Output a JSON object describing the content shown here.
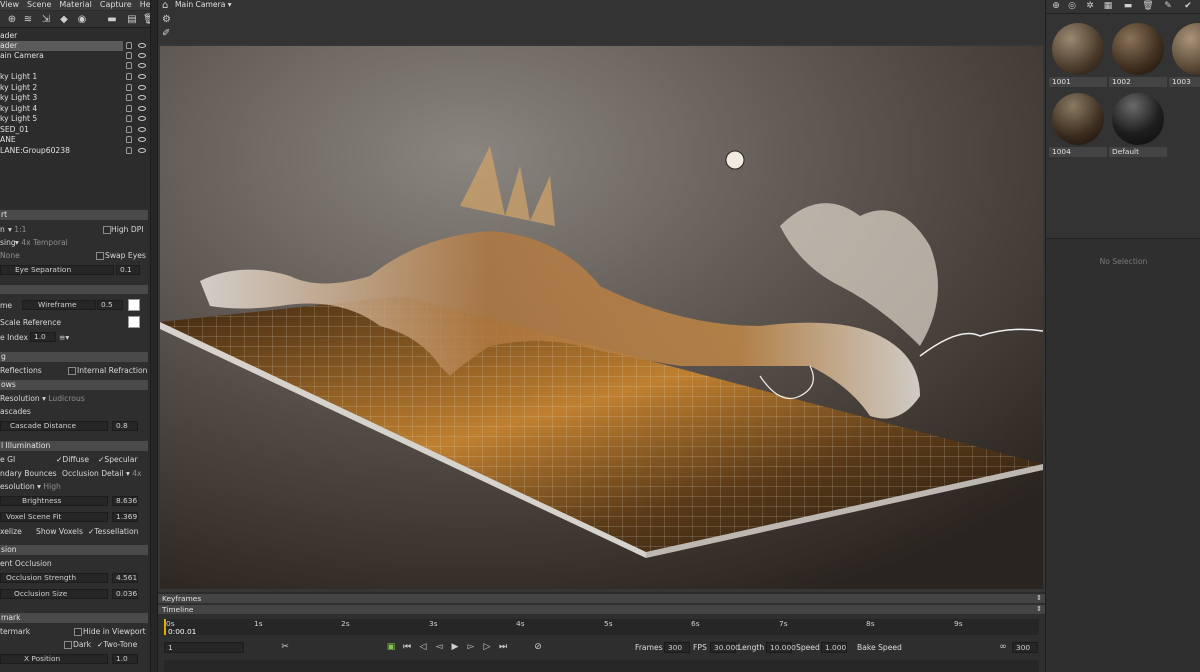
{
  "menubar": [
    "View",
    "Scene",
    "Material",
    "Capture",
    "Help"
  ],
  "left_toolbar_icons": [
    "add-object-icon",
    "clone-icon",
    "import-icon",
    "material-icon",
    "environment-icon",
    "folder-icon",
    "layers-icon",
    "delete-icon"
  ],
  "scene_tree": {
    "items": [
      {
        "label": "ader",
        "selected": true
      },
      {
        "label": "ain Camera",
        "selected": false
      },
      {
        "label": "",
        "selected": false
      },
      {
        "label": "ky Light 1",
        "selected": false
      },
      {
        "label": "ky Light 2",
        "selected": false
      },
      {
        "label": "ky Light 3",
        "selected": false
      },
      {
        "label": "ky Light 4",
        "selected": false
      },
      {
        "label": "ky Light 5",
        "selected": false
      },
      {
        "label": "SED_01",
        "selected": false
      },
      {
        "label": "ANE",
        "selected": false
      },
      {
        "label": "LANE:Group60238",
        "selected": false
      }
    ]
  },
  "props": {
    "rt_header": "rt",
    "res_label": "n",
    "res_value": "1:1",
    "high_dpi": "High DPI",
    "sampling_label": "sing",
    "sampling_value": "4x Temporal",
    "none_value": "None",
    "swap_eyes": "Swap Eyes",
    "eye_sep": "Eye Separation",
    "eye_sep_val": "0.1",
    "frame_label": "me",
    "wireframe": "Wireframe",
    "wire_val": "0.5",
    "scale_ref": "Scale Reference",
    "index_label": "e Index",
    "index_val": "1.0",
    "refl_header": "g",
    "reflections": "Reflections",
    "internal_refraction": "Internal Refraction",
    "shadows_header": "ows",
    "shadow_res": "Resolution",
    "shadow_res_val": "Ludicrous",
    "cascades": "ascades",
    "cascade_dist": "Cascade Distance",
    "cascade_val": "0.8",
    "gi_header": "l Illumination",
    "gi_label": "e GI",
    "diffuse": "Diffuse",
    "specular": "Specular",
    "bounces": "ndary Bounces",
    "occ_detail": "Occlusion Detail",
    "occ_detail_val": "4x",
    "gi_res": "esolution",
    "gi_res_val": "High",
    "brightness": "Brightness",
    "brightness_val": "8.636",
    "voxel_fit": "Voxel Scene Fit",
    "voxel_fit_val": "1.369",
    "voxelize": "xelize",
    "show_voxels": "Show Voxels",
    "tessellation": "Tessellation",
    "occ_header": "sion",
    "ambient_occ": "ent Occlusion",
    "occ_strength": "Occlusion Strength",
    "occ_strength_val": "4.561",
    "occ_size": "Occlusion Size",
    "occ_size_val": "0.036",
    "wm_header": "mark",
    "watermark": "termark",
    "hide_viewport": "Hide in Viewport",
    "dark": "Dark",
    "two_tone": "Two-Tone",
    "x_position": "X Position",
    "x_position_val": "1.0"
  },
  "viewport": {
    "camera": "Main Camera"
  },
  "materials": [
    {
      "label": "1001",
      "color": "#5a4634"
    },
    {
      "label": "1002",
      "color": "#4e3c2a"
    },
    {
      "label": "1003",
      "color": "#6b5a44"
    },
    {
      "label": "1004",
      "color": "#4a3a2a"
    },
    {
      "label": "Default",
      "color": "#2a2a2a"
    }
  ],
  "no_selection": "No Selection",
  "timeline": {
    "keyframes": "Keyframes",
    "timeline": "Timeline",
    "current": "0:00.01",
    "ticks": [
      "0s",
      "1s",
      "2s",
      "3s",
      "4s",
      "5s",
      "6s",
      "7s",
      "8s",
      "9s"
    ],
    "frame_field": "1",
    "frames_label": "Frames",
    "frames_val": "300",
    "fps_label": "FPS",
    "fps_val": "30.000",
    "length_label": "Length",
    "length_val": "10.000",
    "speed_label": "Speed",
    "speed_val": "1.000",
    "bake_speed": "Bake Speed",
    "end_val": "300"
  }
}
